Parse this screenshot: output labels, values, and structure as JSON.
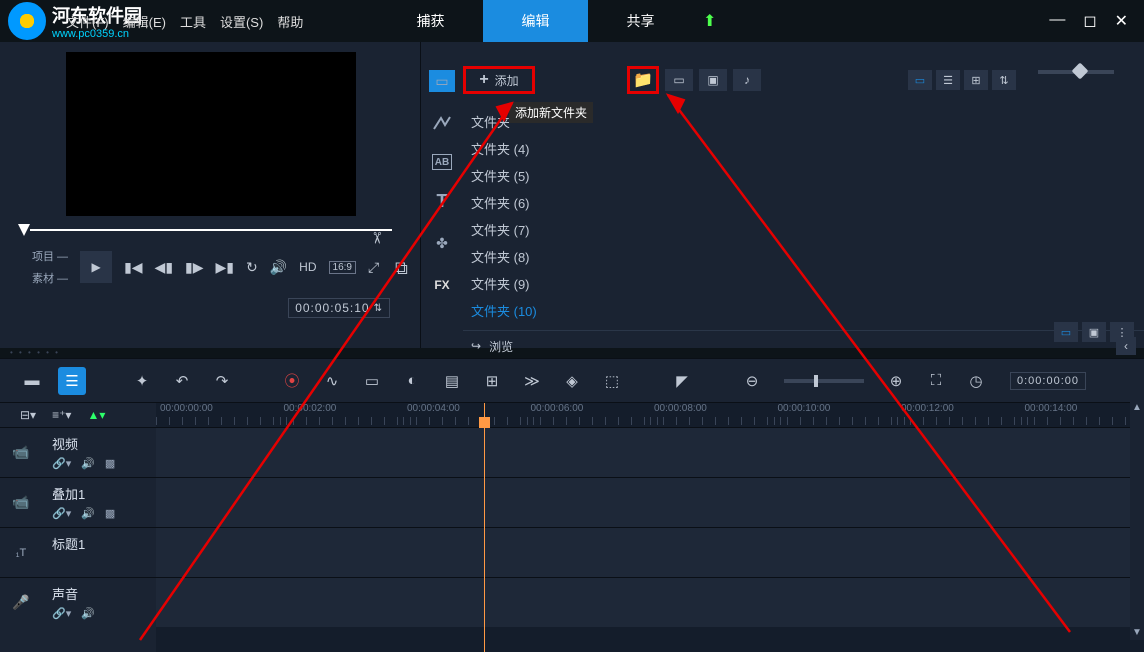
{
  "logo": {
    "title": "河东软件园",
    "url": "www.pc0359.cn"
  },
  "menu": {
    "file": "文件(F)",
    "edit2": "编辑(E)",
    "tools": "工具",
    "settings": "设置(S)",
    "help": "帮助"
  },
  "mainTabs": {
    "capture": "捕获",
    "edit": "编辑",
    "share": "共享"
  },
  "preview": {
    "project": "项目 —",
    "material": "素材 —",
    "hd": "HD",
    "ratio": "16:9",
    "timecode": "00:00:05:10",
    "updown": "⇅"
  },
  "library": {
    "add": "添加",
    "tooltip": "添加新文件夹",
    "folders": [
      "文件夹",
      "文件夹 (4)",
      "文件夹 (5)",
      "文件夹 (6)",
      "文件夹 (7)",
      "文件夹 (8)",
      "文件夹 (9)",
      "文件夹 (10)"
    ],
    "browse": "浏览"
  },
  "sidebar": {
    "fx": "FX"
  },
  "timeline": {
    "timecode": "0:00:00:00",
    "ruler": [
      "00:00:00:00",
      "00:00:02:00",
      "00:00:04:00",
      "00:00:06:00",
      "00:00:08:00",
      "00:00:10:00",
      "00:00:12:00",
      "00:00:14:00"
    ],
    "tracks": {
      "video": "视频",
      "overlay": "叠加1",
      "title": "标题1",
      "audio": "声音"
    }
  }
}
